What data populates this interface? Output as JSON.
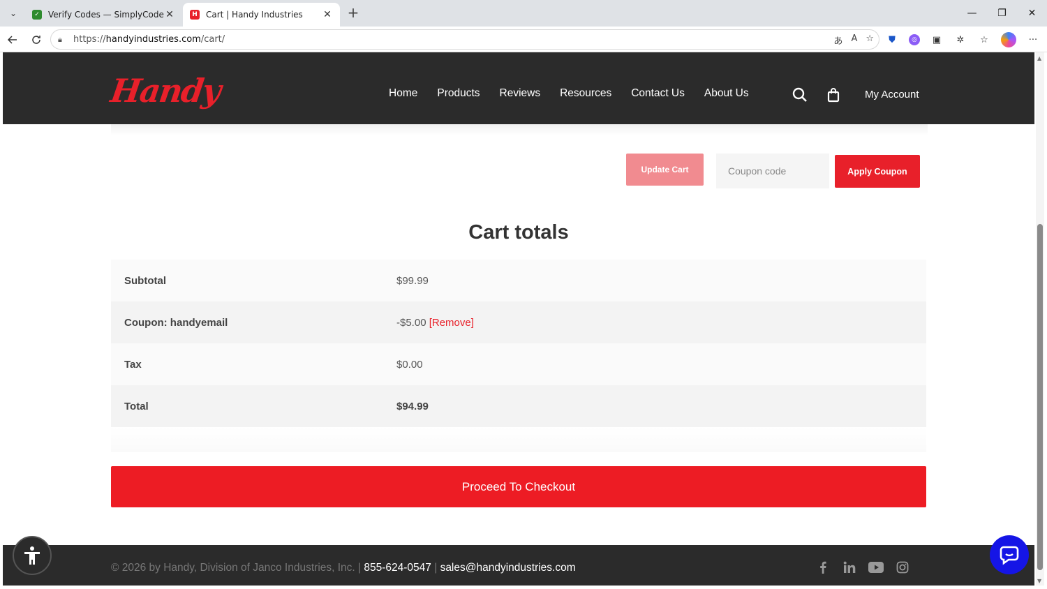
{
  "browser": {
    "tabs": [
      {
        "title": "Verify Codes — SimplyCodes",
        "active": false
      },
      {
        "title": "Cart | Handy Industries",
        "active": true
      }
    ],
    "url_prefix": "https://",
    "url_host": "handyindustries.com",
    "url_path": "/cart/"
  },
  "header": {
    "logo_text": "Handy",
    "nav": [
      "Home",
      "Products",
      "Reviews",
      "Resources",
      "Contact Us",
      "About Us"
    ],
    "my_account": "My Account"
  },
  "cart_actions": {
    "update_cart": "Update Cart",
    "coupon_placeholder": "Coupon code",
    "apply_coupon": "Apply Coupon"
  },
  "totals": {
    "title": "Cart totals",
    "rows": [
      {
        "label": "Subtotal",
        "value": "$99.99"
      },
      {
        "label": "Coupon: handyemail",
        "value": "-$5.00",
        "link": "[Remove]"
      },
      {
        "label": "Tax",
        "value": "$0.00"
      },
      {
        "label": "Total",
        "value": "$94.99"
      }
    ],
    "checkout": "Proceed To Checkout"
  },
  "footer": {
    "copyright": "© 2026 by Handy, Division of Janco Industries, Inc. |",
    "phone": "855-624-0547",
    "separator": "|",
    "email": "sales@handyindustries.com"
  },
  "colors": {
    "brand_red": "#ed1c24",
    "header_dark": "#2b2b2b",
    "chat_blue": "#1515e6"
  }
}
